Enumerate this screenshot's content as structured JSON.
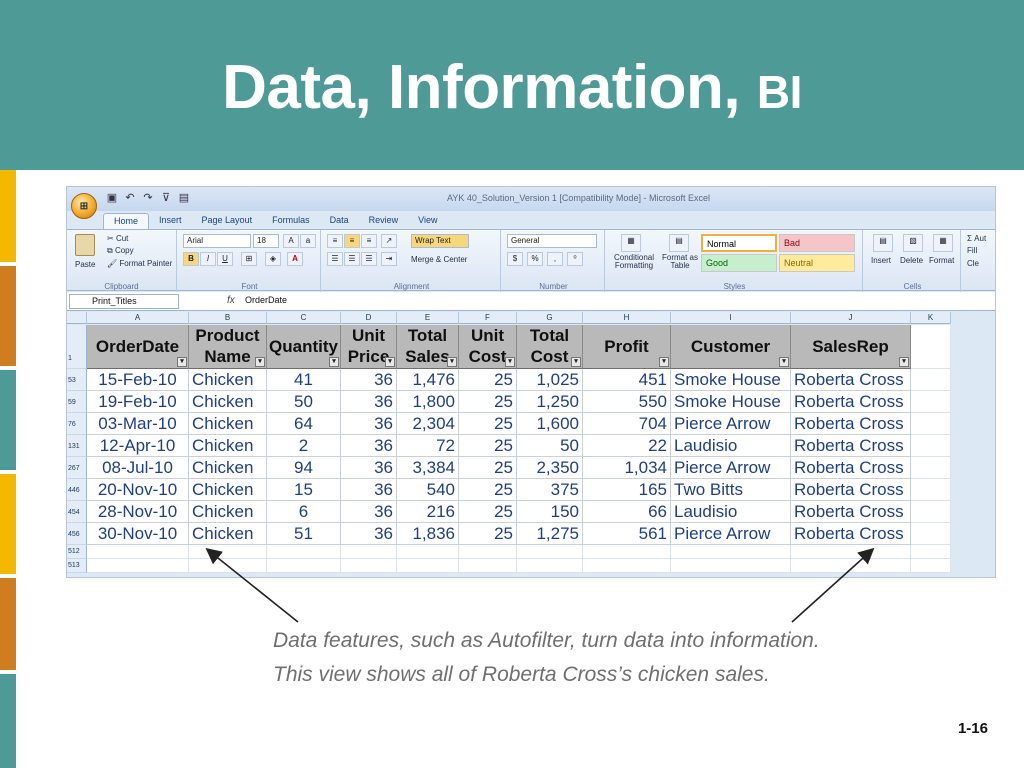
{
  "slide": {
    "title_main": "Data, Information, ",
    "title_bi": "BI",
    "page_number": "1-16",
    "caption_line1": "Data features, such as Autofilter, turn data into information.",
    "caption_line2": "This view shows all of Roberta Cross’s chicken sales."
  },
  "colors": {
    "teal": "#4e9a96",
    "yellow": "#f5b800",
    "orange": "#d07d20",
    "cell_text": "#1f3f86",
    "header_fill": "#b9b9b9"
  },
  "excel": {
    "office_button": "⊞",
    "window_title": "AYK 40_Solution_Version 1 [Compatibility Mode] - Microsoft Excel",
    "tabs": [
      "Home",
      "Insert",
      "Page Layout",
      "Formulas",
      "Data",
      "Review",
      "View"
    ],
    "ribbon": {
      "clipboard": {
        "paste": "Paste",
        "cut": "Cut",
        "copy": "Copy",
        "format_painter": "Format Painter",
        "label": "Clipboard"
      },
      "font": {
        "name": "Arial",
        "size": "18",
        "label": "Font"
      },
      "alignment": {
        "wrap_text": "Wrap Text",
        "merge_center": "Merge & Center",
        "label": "Alignment"
      },
      "number": {
        "format": "General",
        "currency": "$",
        "percent": "%",
        "label": "Number"
      },
      "styles": {
        "conditional": "Conditional Formatting",
        "format_table": "Format as Table",
        "normal": "Normal",
        "bad": "Bad",
        "good": "Good",
        "neutral": "Neutral",
        "label": "Styles"
      },
      "cells": {
        "insert": "Insert",
        "delete": "Delete",
        "format": "Format",
        "label": "Cells"
      },
      "editing": {
        "autosum": "Σ Aut",
        "fill": "Fill",
        "clear": "Cle"
      }
    },
    "name_box": "Print_Titles",
    "fx": "fx",
    "formula_value": "OrderDate",
    "columns": [
      "A",
      "B",
      "C",
      "D",
      "E",
      "F",
      "G",
      "H",
      "I",
      "J",
      "K"
    ],
    "headers": [
      [
        "OrderDate"
      ],
      [
        "Product",
        "Name"
      ],
      [
        "Quantity"
      ],
      [
        "Unit",
        "Price"
      ],
      [
        "Total",
        "Sales"
      ],
      [
        "Unit",
        "Cost"
      ],
      [
        "Total",
        "Cost"
      ],
      [
        "Profit"
      ],
      [
        "Customer"
      ],
      [
        "SalesRep"
      ]
    ],
    "header_row_number": "1",
    "rows": [
      {
        "num": "53",
        "cells": [
          "15-Feb-10",
          "Chicken",
          "41",
          "36",
          "1,476",
          "25",
          "1,025",
          "451",
          "Smoke House",
          "Roberta Cross"
        ]
      },
      {
        "num": "59",
        "cells": [
          "19-Feb-10",
          "Chicken",
          "50",
          "36",
          "1,800",
          "25",
          "1,250",
          "550",
          "Smoke House",
          "Roberta Cross"
        ]
      },
      {
        "num": "76",
        "cells": [
          "03-Mar-10",
          "Chicken",
          "64",
          "36",
          "2,304",
          "25",
          "1,600",
          "704",
          "Pierce Arrow",
          "Roberta Cross"
        ]
      },
      {
        "num": "131",
        "cells": [
          "12-Apr-10",
          "Chicken",
          "2",
          "36",
          "72",
          "25",
          "50",
          "22",
          "Laudisio",
          "Roberta Cross"
        ]
      },
      {
        "num": "267",
        "cells": [
          "08-Jul-10",
          "Chicken",
          "94",
          "36",
          "3,384",
          "25",
          "2,350",
          "1,034",
          "Pierce Arrow",
          "Roberta Cross"
        ]
      },
      {
        "num": "446",
        "cells": [
          "20-Nov-10",
          "Chicken",
          "15",
          "36",
          "540",
          "25",
          "375",
          "165",
          "Two Bitts",
          "Roberta Cross"
        ]
      },
      {
        "num": "454",
        "cells": [
          "28-Nov-10",
          "Chicken",
          "6",
          "36",
          "216",
          "25",
          "150",
          "66",
          "Laudisio",
          "Roberta Cross"
        ]
      },
      {
        "num": "456",
        "cells": [
          "30-Nov-10",
          "Chicken",
          "51",
          "36",
          "1,836",
          "25",
          "1,275",
          "561",
          "Pierce Arrow",
          "Roberta Cross"
        ]
      }
    ],
    "empty_rows": [
      "512",
      "513"
    ]
  }
}
